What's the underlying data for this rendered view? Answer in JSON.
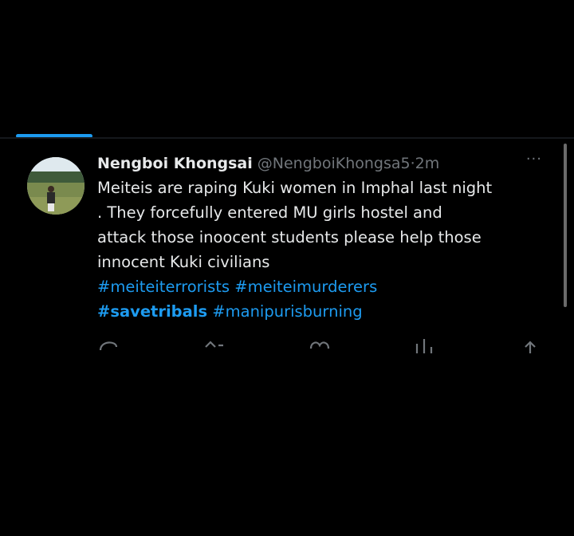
{
  "tweet": {
    "author_name": "Nengboi Khongsai",
    "handle": "@NengboiKhongsa5",
    "separator": "·",
    "time": "2m",
    "more": "···",
    "text_lines": [
      "Meiteis are raping Kuki women in Imphal last night",
      ". They forcefully entered MU girls hostel and",
      "attack those inoocent students please help those",
      "innocent Kuki civilians"
    ],
    "hashtags_line1": [
      "#meiteiterrorists",
      "#meiteimurderers"
    ],
    "hashtags_line2": [
      "#savetribals",
      "#manipurisburning"
    ]
  },
  "colors": {
    "background": "#000000",
    "text": "#e7e9ea",
    "muted": "#71767b",
    "accent": "#1d9bf0"
  },
  "icons": {
    "reply": "reply-icon",
    "retweet": "retweet-icon",
    "like": "like-icon",
    "views": "views-icon",
    "share": "share-icon",
    "more": "more-icon"
  }
}
